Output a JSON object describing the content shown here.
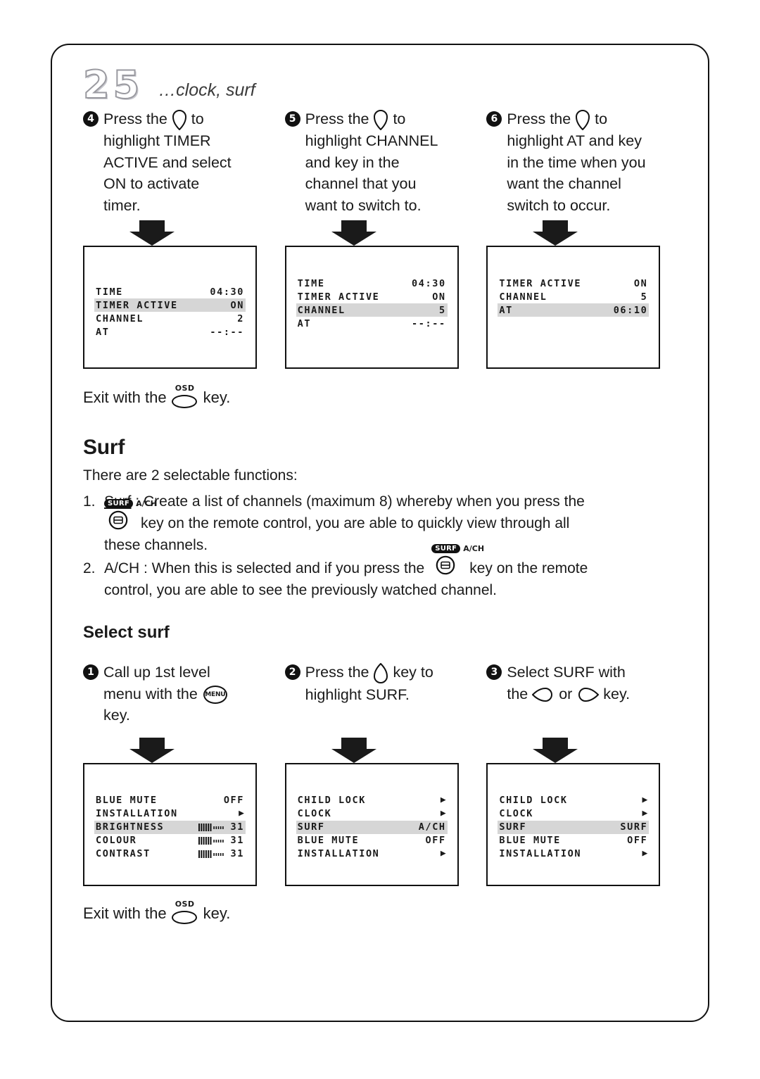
{
  "masthead": {
    "page_number": "25",
    "subtitle": "…clock, surf"
  },
  "timer_steps": [
    {
      "number": "4",
      "lines": [
        "Press the ",
        " to",
        "highlight TIMER",
        "ACTIVE and select",
        "ON to activate",
        "timer."
      ],
      "key_icon": "teardrop-down-key-icon"
    },
    {
      "number": "5",
      "lines": [
        "Press the ",
        " to",
        "highlight CHANNEL",
        "and key in the",
        "channel that you",
        "want to switch to."
      ],
      "key_icon": "teardrop-down-key-icon"
    },
    {
      "number": "6",
      "lines": [
        "Press the ",
        " to",
        "highlight AT and key",
        "in the time when you",
        "want the channel",
        "switch to occur."
      ],
      "key_icon": "teardrop-down-key-icon"
    }
  ],
  "timer_panels": [
    {
      "rows": [
        {
          "label": "TIME",
          "value": "04:30",
          "highlighted": false
        },
        {
          "label": "TIMER ACTIVE",
          "value": "ON",
          "highlighted": true
        },
        {
          "label": "CHANNEL",
          "value": "2",
          "highlighted": false
        },
        {
          "label": "AT",
          "value": "--:--",
          "highlighted": false
        }
      ]
    },
    {
      "rows": [
        {
          "label": "TIME",
          "value": "04:30",
          "highlighted": false
        },
        {
          "label": "TIMER ACTIVE",
          "value": "ON",
          "highlighted": false
        },
        {
          "label": "CHANNEL",
          "value": "5",
          "highlighted": true
        },
        {
          "label": "AT",
          "value": "--:--",
          "highlighted": false
        }
      ]
    },
    {
      "rows": [
        {
          "label": "TIMER ACTIVE",
          "value": "ON",
          "highlighted": false
        },
        {
          "label": "CHANNEL",
          "value": "5",
          "highlighted": false
        },
        {
          "label": "AT",
          "value": "06:10",
          "highlighted": true
        }
      ]
    }
  ],
  "exit_note_top": {
    "before": "Exit with the",
    "after": "key.",
    "key_label": "OSD",
    "key_icon": "osd-key-icon"
  },
  "surf_section": {
    "title": "Surf",
    "lead": "There are 2 selectable functions:",
    "items": [
      {
        "marker": "1.",
        "term": "Surf",
        "line1_after_term": " : Create a list of channels (maximum 8) whereby when you press the",
        "line2": "key on the remote control, you are able to quickly view through all",
        "line3": "these channels.",
        "badge_pill": "SURF",
        "badge_alt": "A/CH"
      },
      {
        "marker": "2.",
        "line1_a": "A/CH : When this is selected and if you press the",
        "line1_b": "key on the remote",
        "line2": "control, you are able to see the previously watched channel.",
        "badge_pill": "SURF",
        "badge_alt": "A/CH"
      }
    ]
  },
  "select_surf": {
    "title": "Select surf",
    "steps": [
      {
        "number": "1",
        "lines": [
          "Call up 1st level",
          "menu with the ",
          "key."
        ],
        "key_label": "MENU",
        "key_icon": "menu-key-icon"
      },
      {
        "number": "2",
        "lines": [
          "Press the ",
          " key to",
          "highlight SURF."
        ],
        "key_icon": "teardrop-up-key-icon"
      },
      {
        "number": "3",
        "lines": [
          "Select SURF with",
          "the ",
          " or ",
          " key."
        ],
        "key_icon_left": "teardrop-left-key-icon",
        "key_icon_right": "teardrop-right-key-icon"
      }
    ]
  },
  "surf_panels": [
    {
      "rows": [
        {
          "label": "BLUE MUTE",
          "value": "OFF",
          "type": "text",
          "highlighted": false
        },
        {
          "label": "INSTALLATION",
          "value": "▶",
          "type": "arrow",
          "highlighted": false
        },
        {
          "label": "BRIGHTNESS",
          "value": "31",
          "type": "gauge",
          "gauge_filled": 6,
          "gauge_empty": 5,
          "highlighted": true
        },
        {
          "label": "COLOUR",
          "value": "31",
          "type": "gauge",
          "gauge_filled": 6,
          "gauge_empty": 5,
          "highlighted": false
        },
        {
          "label": "CONTRAST",
          "value": "31",
          "type": "gauge",
          "gauge_filled": 6,
          "gauge_empty": 5,
          "highlighted": false
        }
      ]
    },
    {
      "rows": [
        {
          "label": "CHILD LOCK",
          "value": "▶",
          "type": "arrow",
          "highlighted": false
        },
        {
          "label": "CLOCK",
          "value": "▶",
          "type": "arrow",
          "highlighted": false
        },
        {
          "label": "SURF",
          "value": "A/CH",
          "type": "text",
          "highlighted": true
        },
        {
          "label": "BLUE MUTE",
          "value": "OFF",
          "type": "text",
          "highlighted": false
        },
        {
          "label": "INSTALLATION",
          "value": "▶",
          "type": "arrow",
          "highlighted": false
        }
      ]
    },
    {
      "rows": [
        {
          "label": "CHILD LOCK",
          "value": "▶",
          "type": "arrow",
          "highlighted": false
        },
        {
          "label": "CLOCK",
          "value": "▶",
          "type": "arrow",
          "highlighted": false
        },
        {
          "label": "SURF",
          "value": "SURF",
          "type": "text",
          "highlighted": true
        },
        {
          "label": "BLUE MUTE",
          "value": "OFF",
          "type": "text",
          "highlighted": false
        },
        {
          "label": "INSTALLATION",
          "value": "▶",
          "type": "arrow",
          "highlighted": false
        }
      ]
    }
  ],
  "exit_note_bottom": {
    "before": "Exit with the",
    "after": "key.",
    "key_label": "OSD",
    "key_icon": "osd-key-icon"
  },
  "colors": {
    "ink": "#1a1a1a",
    "highlight_row": "#d6d6d6",
    "page_number_outline": "#9a9aa0"
  }
}
